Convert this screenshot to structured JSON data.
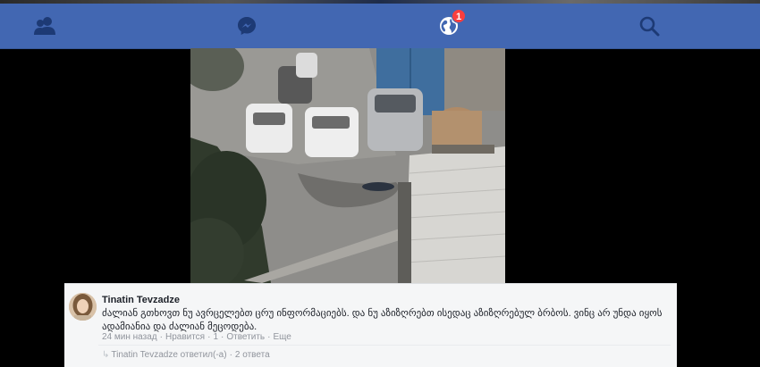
{
  "navbar": {
    "background": "#4267b2",
    "icons": [
      {
        "name": "friends-icon"
      },
      {
        "name": "messenger-icon"
      },
      {
        "name": "notifications-globe-icon",
        "badge": "1"
      },
      {
        "name": "search-icon"
      }
    ]
  },
  "post": {
    "photo": {
      "description_icon": "photo-parking-lot"
    }
  },
  "comment": {
    "author": "Tinatin Tevzadze",
    "text": "ძალიან გთხოვთ ნუ ავრცელებთ ცრუ ინფორმაციებს. და ნუ აზიზღრებთ ისედაც აზიზღრებულ ბრბოს. ვინც არ უნდა იყოს ადამიანია და ძალიან მეცოდება.",
    "time": "24 мин назад",
    "like": "Нравится",
    "reactions_count": "1",
    "reply": "Ответить",
    "more": "Еще",
    "replies_author": "Tinatin Tevzadze ответил(-а)",
    "replies_count": "2 ответа"
  }
}
